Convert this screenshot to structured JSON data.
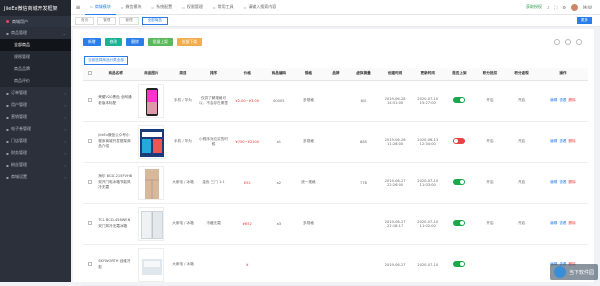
{
  "app": {
    "title": "JiieEx微信商城开发框架",
    "user_label": "商城用户"
  },
  "sidebar": [
    {
      "label": "商品管理",
      "type": "group",
      "open": true
    },
    {
      "label": "全部商品",
      "type": "sub",
      "active": true
    },
    {
      "label": "规格管理",
      "type": "sub"
    },
    {
      "label": "商品品牌",
      "type": "sub"
    },
    {
      "label": "商品评价",
      "type": "sub"
    },
    {
      "label": "订单管理",
      "type": "group"
    },
    {
      "label": "用户管理",
      "type": "group"
    },
    {
      "label": "营销管理",
      "type": "group"
    },
    {
      "label": "电子券管理",
      "type": "group"
    },
    {
      "label": "门店管理",
      "type": "group"
    },
    {
      "label": "财务管理",
      "type": "group"
    },
    {
      "label": "粉丝管理",
      "type": "group"
    },
    {
      "label": "商城设置",
      "type": "group"
    }
  ],
  "topnav": {
    "tabs": [
      "商城模块",
      "微信模块",
      "系统配置",
      "权限管理",
      "常用工具",
      "请输入搜索内容"
    ],
    "right_a": "获取授权",
    "right_b": "MrW"
  },
  "tabbar": {
    "tabs": [
      "首页",
      "管理",
      "管理",
      "全部商品"
    ],
    "more": "更多"
  },
  "toolbar": {
    "add": "新增",
    "edit": "修改",
    "del": "删除",
    "up": "批量上架",
    "down": "批量下架"
  },
  "filter": "当前选择商品分类全部",
  "table": {
    "headers": [
      "",
      "商品名称",
      "商品图片",
      "类目",
      "排序",
      "价格",
      "商品编码",
      "规格",
      "品牌",
      "虚拟销量",
      "创建时间",
      "更新时间",
      "是否上架",
      "积分抵扣",
      "积分返现",
      "操作"
    ],
    "rows": [
      {
        "name": "荣耀V20黑色 全网通 老版本标配",
        "cat": "手机 / 华为",
        "sort": "仅供了解规格可以，不会存在哪里",
        "price": "¥2.00~¥3.00",
        "code": "00005",
        "spec": "多规格",
        "brand": "",
        "sales": "6/0",
        "ctime": "2019-06-28 14:51:00",
        "utime": "2020-07-10 15:27:00",
        "on": true,
        "p1": "开启",
        "p2": "开启"
      },
      {
        "name": "JiieEx微信公众号小程序商城开发框架商品介绍",
        "cat": "手机 / 华为",
        "sort": "小程序对应买的时候",
        "price": "¥750~¥2100",
        "code": "a1",
        "spec": "多规格",
        "brand": "",
        "sales": "885",
        "ctime": "2019-06-26 11:28:00",
        "utime": "2020-06-13 12:34:00",
        "on": false,
        "p1": "开启",
        "p2": "开启"
      },
      {
        "name": "海尔 BCD-215FVHB 双开门电冰箱节能风冷无霜",
        "cat": "大家电 / 冰箱",
        "sort": "金色 三门 1:1",
        "price": "¥52",
        "code": "a2",
        "spec": "统一规格",
        "brand": "",
        "sales": "778",
        "ctime": "2019-06-27 22:26:00",
        "utime": "2020-07-10 11:03:00",
        "on": true,
        "p1": "开启",
        "p2": "开启"
      },
      {
        "name": "TCL BCD-458WEN 双门风冷无霜冰箱",
        "cat": "大家电 / 冰箱",
        "sort": "冷藏无霜",
        "price": "¥652",
        "code": "a3",
        "spec": "多规格",
        "brand": "",
        "sales": "",
        "ctime": "2019-06-27 22:18:17",
        "utime": "2020-07-10 11:02:00",
        "on": true,
        "p1": "开启",
        "p2": "开启"
      },
      {
        "name": "SKYWORTH 创维冷柜",
        "cat": "大家电 / 冰箱",
        "sort": "",
        "price": "¥",
        "code": "",
        "spec": "",
        "brand": "",
        "sales": "",
        "ctime": "2019-06-27",
        "utime": "2020-07-10",
        "on": true,
        "p1": "",
        "p2": ""
      }
    ],
    "ops": {
      "edit": "编辑",
      "view": "查看",
      "del": "删除"
    }
  },
  "watermark": "当下软件园"
}
